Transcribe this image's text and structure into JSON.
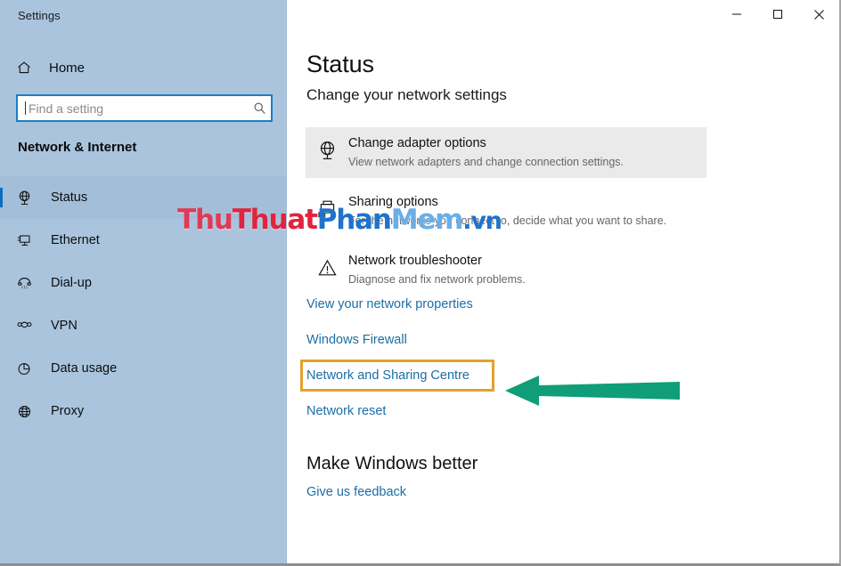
{
  "window": {
    "title": "Settings",
    "controls": [
      {
        "name": "minimize",
        "glyph": "—"
      },
      {
        "name": "maximize",
        "glyph": "□"
      },
      {
        "name": "close",
        "glyph": "✕"
      }
    ]
  },
  "sidebar": {
    "home_label": "Home",
    "home_icon": "home-icon",
    "section_title": "Network & Internet",
    "search": {
      "placeholder": "Find a setting",
      "value": "",
      "icon": "search-icon"
    },
    "items": [
      {
        "label": "Status",
        "icon": "globe-stand-icon",
        "selected": true
      },
      {
        "label": "Ethernet",
        "icon": "monitor-icon",
        "selected": false
      },
      {
        "label": "Dial-up",
        "icon": "telephone-icon",
        "selected": false
      },
      {
        "label": "VPN",
        "icon": "vpn-icon",
        "selected": false
      },
      {
        "label": "Data usage",
        "icon": "pie-chart-icon",
        "selected": false
      },
      {
        "label": "Proxy",
        "icon": "globe-icon",
        "selected": false
      }
    ]
  },
  "main": {
    "title": "Status",
    "subtitle": "Change your network settings",
    "options": [
      {
        "title": "Change adapter options",
        "desc": "View network adapters and change connection settings.",
        "icon": "globe-stand-icon",
        "hovered": true
      },
      {
        "title": "Sharing options",
        "desc": "For the networks you connect to, decide what you want to share.",
        "icon": "sharing-printer-icon",
        "hovered": false
      },
      {
        "title": "Network troubleshooter",
        "desc": "Diagnose and fix network problems.",
        "icon": "warning-triangle-icon",
        "hovered": false
      }
    ],
    "links": [
      {
        "label": "View your network properties",
        "highlighted": false
      },
      {
        "label": "Windows Firewall",
        "highlighted": false
      },
      {
        "label": "Network and Sharing Centre",
        "highlighted": true
      },
      {
        "label": "Network reset",
        "highlighted": false
      }
    ],
    "footer_heading": "Make Windows better",
    "footer_link": "Give us feedback"
  },
  "annotations": {
    "highlight_color": "#e2a22e",
    "arrow_color": "#0f9e77",
    "arrow_direction": "left",
    "arrow_target": "Network and Sharing Centre"
  },
  "watermark": {
    "parts": [
      {
        "text": "Thu",
        "color": "#e03a56"
      },
      {
        "text": "Thuat",
        "color": "#e0243f"
      },
      {
        "text": "Phan",
        "color": "#1f73cc"
      },
      {
        "text": "Mem",
        "color": "#69aee6"
      },
      {
        "text": ".vn",
        "color": "#1f73cc"
      }
    ],
    "full_text": "ThuThuatPhanMem.vn"
  },
  "theme": {
    "sidebar_bg": "#aac4dd",
    "accent": "#0a6ebd",
    "link_color": "#1b6ea5",
    "card_hover": "#eaeaea"
  }
}
